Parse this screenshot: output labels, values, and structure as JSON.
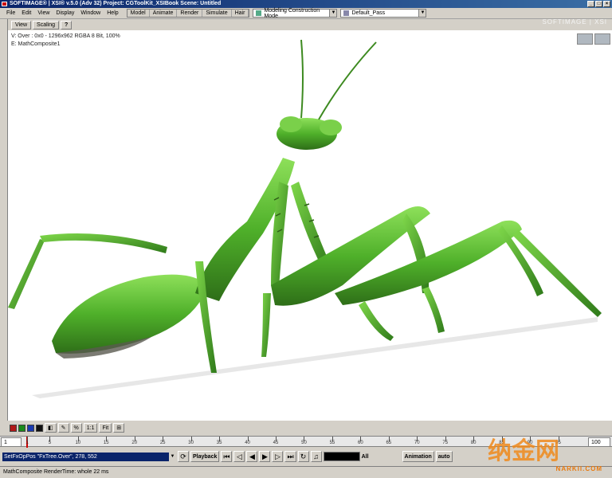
{
  "window": {
    "title": "SOFTIMAGE® | XSI® v.5.0 (Adv 32) Project: CGToolKit_XSIBook   Scene: Untitled",
    "buttons": [
      "_",
      "□",
      "×"
    ]
  },
  "menubar": {
    "items": [
      "File",
      "Edit",
      "View",
      "Display",
      "Window",
      "Help"
    ],
    "modes": [
      "Model",
      "Animate",
      "Render",
      "Simulate",
      "Hair"
    ],
    "construction_mode": "Modeling Construction Mode",
    "pass": "Default_Pass",
    "brand": "SOFTIMAGE | XSI"
  },
  "viewer": {
    "view_label": "View",
    "scaling_label": "Scaling",
    "help_label": "?",
    "info_line1": "V: Over : 0x0 - 1296x962 RGBA 8 Bit, 100%",
    "info_line2": "E: MathComposite1"
  },
  "bottom_toolbar": {
    "channel_colors": [
      "#b01818",
      "#1a8a1a",
      "#1a3ab0",
      "#101010"
    ],
    "ratio_label": "1:1",
    "fit_label": "Fit"
  },
  "timeline": {
    "start": "1",
    "end": "100",
    "ticks": [
      "1",
      "5",
      "10",
      "15",
      "20",
      "25",
      "30",
      "35",
      "40",
      "45",
      "50",
      "55",
      "60",
      "65",
      "70",
      "75",
      "80",
      "85",
      "90",
      "95"
    ]
  },
  "playback": {
    "command": "SetFxOpPos \"FxTree.Over\", 278, 552",
    "playback_label": "Playback",
    "all_label": "All",
    "animation_label": "Animation",
    "auto_label": "auto"
  },
  "status": {
    "text": "MathComposite RenderTime: whole 22 ms"
  },
  "watermark": {
    "url": "NARKII.COM"
  },
  "colors": {
    "accent": "#0a246a",
    "panel": "#d4d0c8",
    "mantis_green": "#4fb02a"
  }
}
